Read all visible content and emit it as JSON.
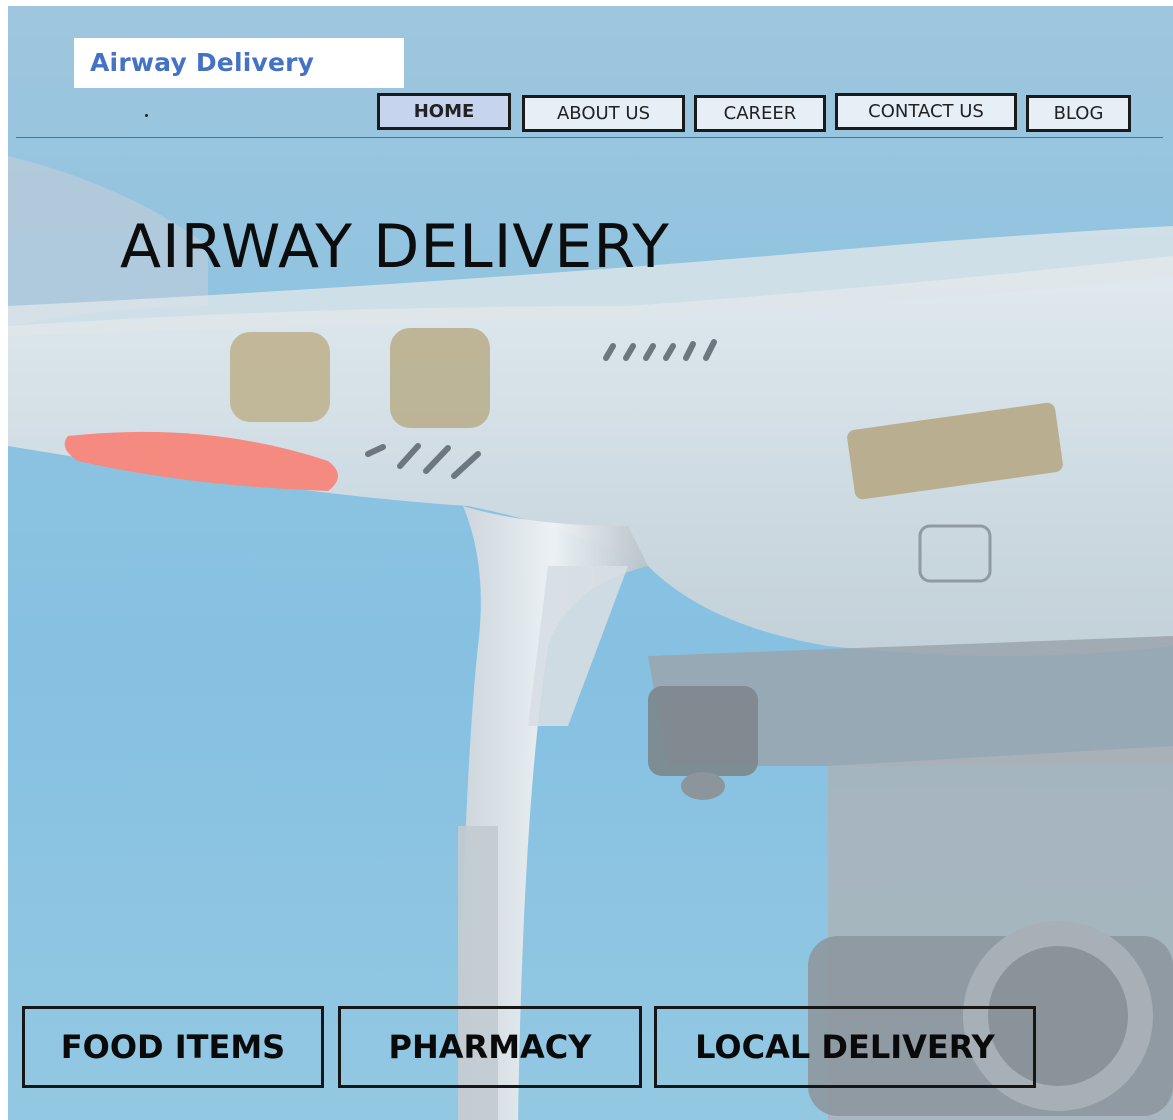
{
  "brand": {
    "name": "Airway Delivery",
    "color": "#4472c4"
  },
  "nav": {
    "items": [
      {
        "label": "HOME",
        "active": true
      },
      {
        "label": "ABOUT US",
        "active": false
      },
      {
        "label": "CAREER",
        "active": false
      },
      {
        "label": "CONTACT US",
        "active": false
      },
      {
        "label": "BLOG",
        "active": false
      }
    ],
    "separator_color": "#4b6cb0"
  },
  "hero": {
    "title": "AIRWAY DELIVERY",
    "background_image": "drone-photo",
    "sky_color": "#86c1e2"
  },
  "categories": [
    {
      "label": "FOOD ITEMS"
    },
    {
      "label": "PHARMACY"
    },
    {
      "label": "LOCAL DELIVERY"
    }
  ]
}
